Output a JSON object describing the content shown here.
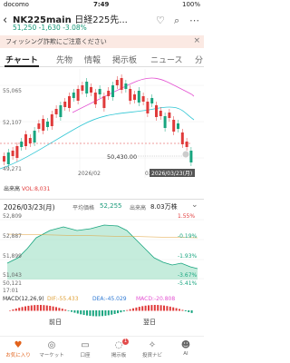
{
  "status_bar": {
    "carrier": "docomo",
    "time": "7:49",
    "battery": "100%"
  },
  "header": {
    "symbol": "NK225main",
    "name": "日経225先...",
    "price": "51,250",
    "change": "-1,630",
    "change_pct": "-3.08%"
  },
  "banner": {
    "text": "フィッシング詐欺にご注意ください"
  },
  "tabs": [
    "チャート",
    "先物",
    "情報",
    "掲示板",
    "ニュース",
    "分"
  ],
  "daily_chart": {
    "y_labels": [
      "55,065",
      "52,107",
      "49,271"
    ],
    "x_labels": [
      "2026/02",
      "03"
    ],
    "last_label": "50,430.00",
    "date_badge": "2026/03/23(月)",
    "volume_label": "出来高",
    "volume_value": "VOL:8,031"
  },
  "intraday": {
    "date": "2026/03/23(月)",
    "avg_label": "平均価格",
    "avg_value": "52,255",
    "vol_label": "出来高",
    "vol_value": "8.03万株",
    "left_labels": [
      "52,809",
      "52,887",
      "51,899",
      "51,043",
      "50,121"
    ],
    "right_labels": [
      "1.55%",
      "-0.19%",
      "-1.93%",
      "-3.67%",
      "-5.41%"
    ],
    "time_start": "17:01",
    "macd_label": "MACD(12,26,9)",
    "dif": "DIF:-55.433",
    "dea": "DEA:-45.029",
    "macd": "MACD:-20.808",
    "prev_label": "前日",
    "next_label": "翌日",
    "colors": {
      "up": "#e03a3a",
      "down": "#18a57f",
      "area": "#9ee0c5",
      "ma_long": "#e34fd1",
      "ma_short": "#2fc6d4"
    }
  },
  "tabbar": [
    {
      "label": "お気に入り",
      "icon": "heart-icon"
    },
    {
      "label": "マーケット",
      "icon": "globe-icon"
    },
    {
      "label": "口座",
      "icon": "wallet-icon"
    },
    {
      "label": "掲示板",
      "icon": "chat-icon",
      "badge": "1"
    },
    {
      "label": "投資ナビ",
      "icon": "compass-icon"
    },
    {
      "label": "AI",
      "icon": "ai-icon"
    }
  ]
}
